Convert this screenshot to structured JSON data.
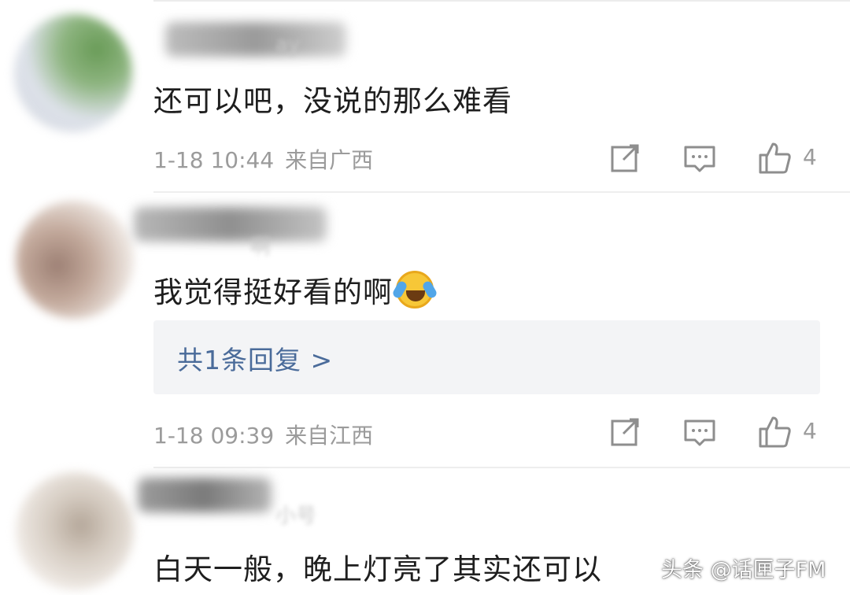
{
  "comments": [
    {
      "name_hint": "ay",
      "text": "还可以吧，没说的那么难看",
      "time": "1-18 10:44",
      "location": "来自广西",
      "likes": "4"
    },
    {
      "name_hint": "啊",
      "text": "我觉得挺好看的啊",
      "reply_label": "共1条回复 >",
      "time": "1-18 09:39",
      "location": "来自江西",
      "likes": "4",
      "emoji": "laughing-crying-emoji"
    },
    {
      "name_hint": "小号",
      "text": "白天一般，晚上灯亮了其实还可以"
    }
  ],
  "watermark": "头条 @话匣子FM",
  "colors": {
    "meta_gray": "#9b9b9b",
    "reply_link": "#4a6b9a",
    "reply_bg": "#f3f4f6",
    "icon_gray": "#8e8e8e"
  },
  "icons": [
    "share-icon",
    "comment-icon",
    "like-icon"
  ]
}
